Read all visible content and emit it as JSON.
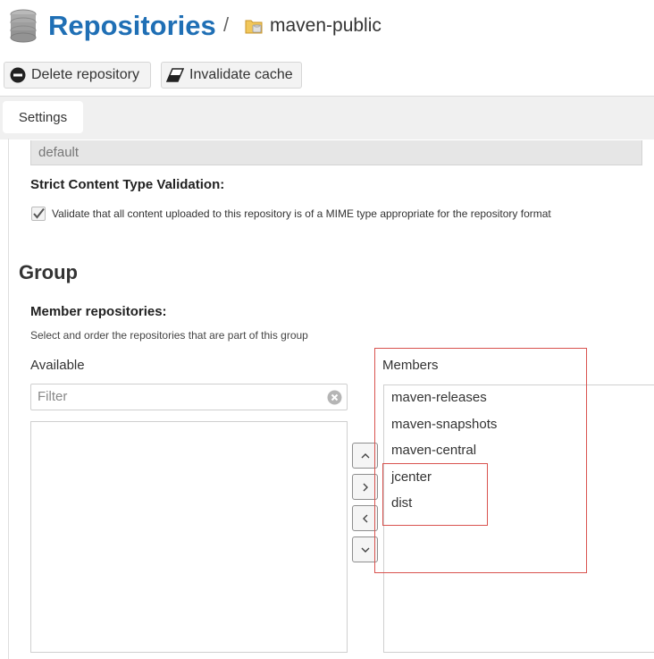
{
  "header": {
    "title": "Repositories",
    "separator": "/",
    "repo_name": "maven-public",
    "icons": [
      "database-icon",
      "folder-icon"
    ]
  },
  "toolbar": {
    "delete_label": "Delete repository",
    "invalidate_label": "Invalidate cache"
  },
  "tabs": [
    {
      "label": "Settings",
      "active": true
    }
  ],
  "storage": {
    "blob_store_value": "default"
  },
  "validation": {
    "label": "Strict Content Type Validation:",
    "checkbox_label": "Validate that all content uploaded to this repository is of a MIME type appropriate for the repository format",
    "checked": true
  },
  "group": {
    "heading": "Group",
    "member_label": "Member repositories:",
    "member_help": "Select and order the repositories that are part of this group",
    "available_label": "Available",
    "members_label": "Members",
    "filter_placeholder": "Filter",
    "available_items": [],
    "members": [
      "maven-releases",
      "maven-snapshots",
      "maven-central",
      "jcenter",
      "dist"
    ]
  },
  "colors": {
    "title": "#1f6fb5",
    "annotation": "#d9534f"
  }
}
